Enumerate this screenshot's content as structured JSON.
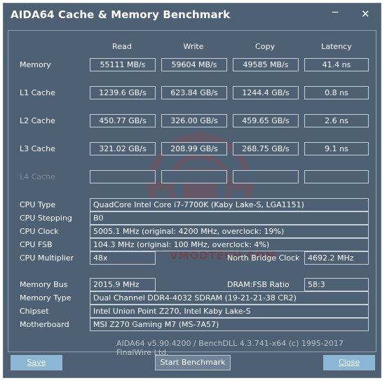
{
  "window": {
    "title": "AIDA64 Cache & Memory Benchmark",
    "min_icon": "minimize-icon",
    "close_icon": "close-icon"
  },
  "columns": [
    "Read",
    "Write",
    "Copy",
    "Latency"
  ],
  "rows": [
    {
      "label": "Memory",
      "read": "55111 MB/s",
      "write": "59604 MB/s",
      "copy": "49585 MB/s",
      "latency": "41.4 ns"
    },
    {
      "label": "L1 Cache",
      "read": "1239.6 GB/s",
      "write": "623.84 GB/s",
      "copy": "1244.4 GB/s",
      "latency": "0.8 ns"
    },
    {
      "label": "L2 Cache",
      "read": "450.77 GB/s",
      "write": "326.00 GB/s",
      "copy": "459.65 GB/s",
      "latency": "2.6 ns"
    },
    {
      "label": "L3 Cache",
      "read": "321.02 GB/s",
      "write": "208.99 GB/s",
      "copy": "268.75 GB/s",
      "latency": "9.1 ns"
    },
    {
      "label": "L4 Cache",
      "read": "",
      "write": "",
      "copy": "",
      "latency": ""
    }
  ],
  "cpu": {
    "type_label": "CPU Type",
    "type": "QuadCore Intel Core i7-7700K  (Kaby Lake-S, LGA1151)",
    "stepping_label": "CPU Stepping",
    "stepping": "B0",
    "clock_label": "CPU Clock",
    "clock": "5005.1 MHz  (original: 4200 MHz, overclock: 19%)",
    "fsb_label": "CPU FSB",
    "fsb": "104.3 MHz  (original: 100 MHz, overclock: 4%)",
    "multiplier_label": "CPU Multiplier",
    "multiplier": "48x",
    "nb_clock_label": "North Bridge Clock",
    "nb_clock": "4692.2 MHz"
  },
  "memory": {
    "bus_label": "Memory Bus",
    "bus": "2015.9 MHz",
    "ratio_label": "DRAM:FSB Ratio",
    "ratio": "58:3",
    "type_label": "Memory Type",
    "type": "Dual Channel DDR4-4032 SDRAM  (19-21-21-38 CR2)",
    "chipset_label": "Chipset",
    "chipset": "Intel Union Point Z270, Intel Kaby Lake-S",
    "mb_label": "Motherboard",
    "motherboard": "MSI Z270 Gaming M7 (MS-7A57)"
  },
  "footer": "AIDA64 v5.90.4200 / BenchDLL 4.3.741-x64  (c) 1995-2017 FinalWire Ltd.",
  "watermark": "VMODTECH.COM",
  "buttons": {
    "save": "Save",
    "start": "Start Benchmark",
    "close": "Close"
  },
  "colors": {
    "window_bg": "#4e6073",
    "button_bg": "#8ab7d6",
    "cell_border": "#c7cfd7"
  }
}
